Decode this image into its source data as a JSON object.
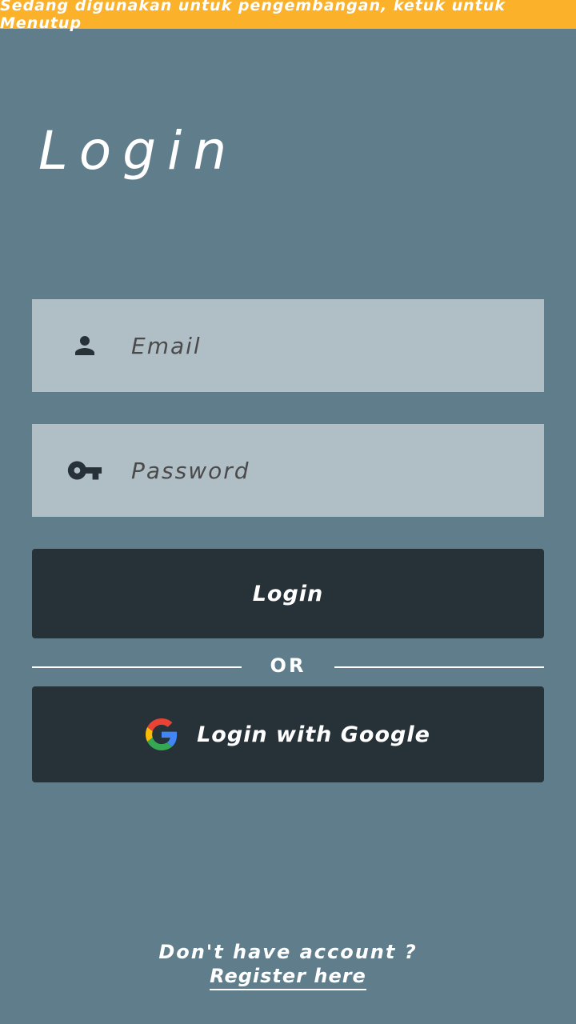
{
  "banner": {
    "text": "Sedang digunakan untuk pengembangan, ketuk untuk Menutup",
    "color": "#fbb12a"
  },
  "page": {
    "title": "Login",
    "background": "#607d8b"
  },
  "form": {
    "email": {
      "placeholder": "Email",
      "value": "",
      "icon": "person-icon"
    },
    "password": {
      "placeholder": "Password",
      "value": "",
      "icon": "key-icon"
    },
    "login_button_label": "Login",
    "divider_label": "OR",
    "google_button_label": "Login with Google",
    "google_icon": "google-g-icon"
  },
  "footer": {
    "question": "Don't have account ?",
    "register_link": "Register here"
  }
}
